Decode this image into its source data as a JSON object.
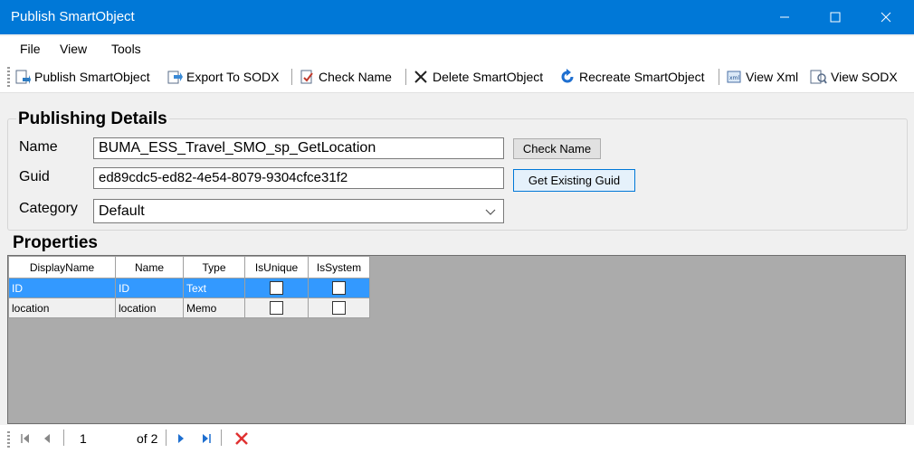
{
  "window": {
    "title": "Publish SmartObject"
  },
  "menu": [
    "File",
    "View",
    "Tools"
  ],
  "toolbar": {
    "publish": "Publish SmartObject",
    "export": "Export To SODX",
    "check": "Check Name",
    "delete": "Delete SmartObject",
    "recreate": "Recreate SmartObject",
    "view_xml": "View Xml",
    "view_sodx": "View SODX"
  },
  "details": {
    "title": "Publishing Details",
    "name_label": "Name",
    "name_value": "BUMA_ESS_Travel_SMO_sp_GetLocation",
    "check_button": "Check Name",
    "guid_label": "Guid",
    "guid_value": "ed89cdc5-ed82-4e54-8079-9304cfce31f2",
    "guid_button": "Get Existing Guid",
    "category_label": "Category",
    "category_value": "Default"
  },
  "properties": {
    "title": "Properties",
    "columns": [
      "DisplayName",
      "Name",
      "Type",
      "IsUnique",
      "IsSystem"
    ],
    "rows": [
      {
        "displayname": "ID",
        "name": "ID",
        "type": "Text",
        "isunique": false,
        "issystem": false
      },
      {
        "displayname": "location",
        "name": "location",
        "type": "Memo",
        "isunique": false,
        "issystem": false
      }
    ]
  },
  "pager": {
    "current": "1",
    "of_label": "of 2"
  },
  "colors": {
    "titlebar": "#0078d7",
    "selection": "#3399ff",
    "grid_bg": "#ababab"
  }
}
